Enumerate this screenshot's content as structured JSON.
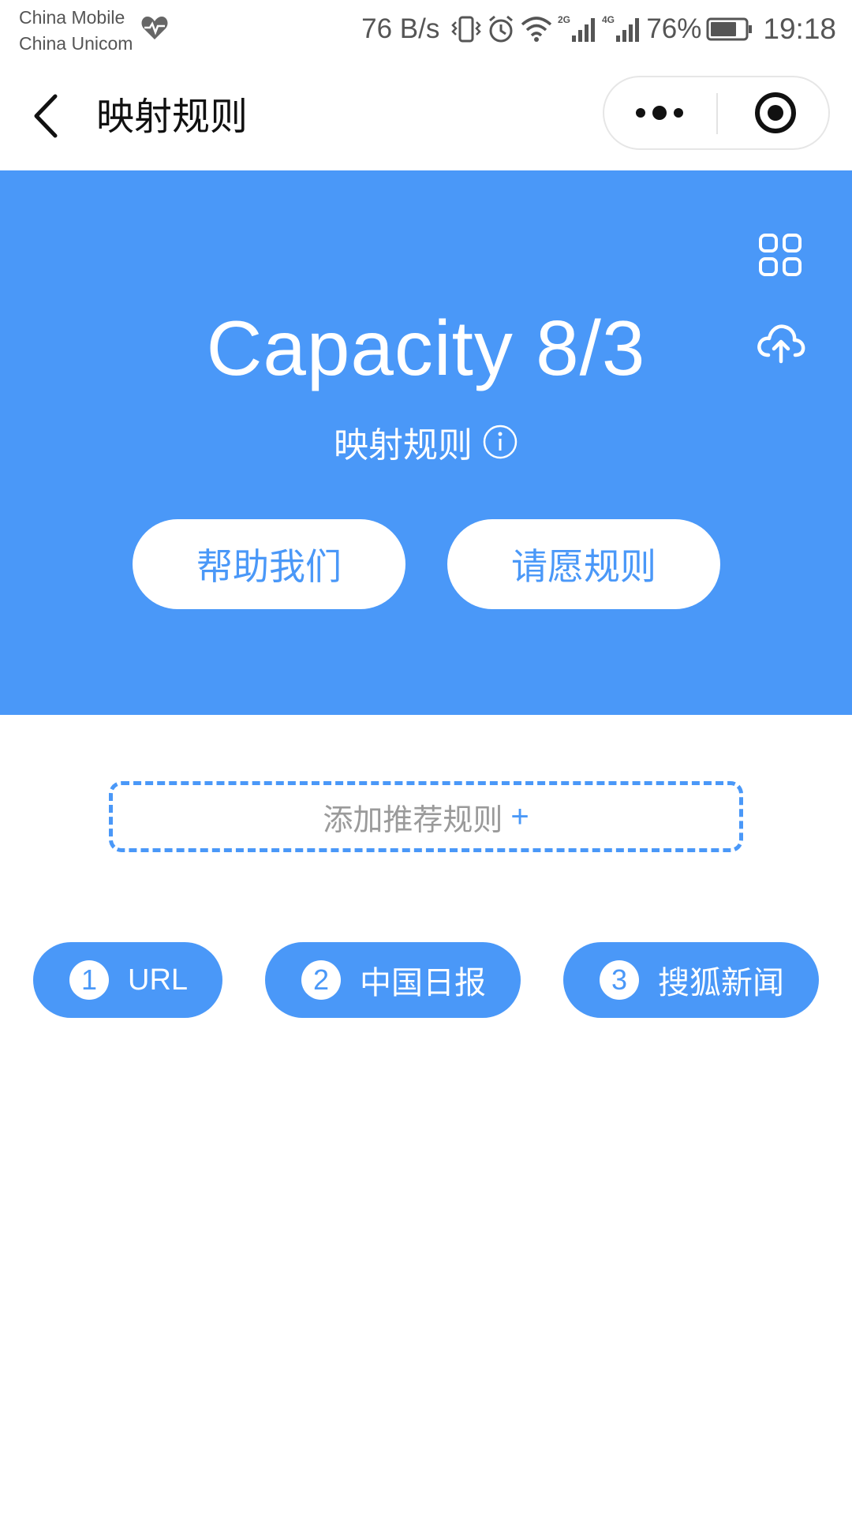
{
  "status_bar": {
    "carrier_1": "China Mobile",
    "carrier_2": "China Unicom",
    "net_speed": "76 B/s",
    "battery_percent": "76%",
    "battery_level": 0.76,
    "time": "19:18",
    "icons": [
      "heart-pulse-icon",
      "vibrate-icon",
      "alarm-icon",
      "wifi-icon",
      "signal-2g-icon",
      "signal-4g-icon",
      "battery-icon"
    ]
  },
  "nav": {
    "title": "映射规则",
    "icons": [
      "back-arrow-icon",
      "more-dots-icon",
      "close-target-icon"
    ]
  },
  "hero": {
    "capacity_text": "Capacity 8/3",
    "subtitle": "映射规则",
    "help_button": "帮助我们",
    "wish_button": "请愿规则",
    "icons": [
      "grid-icon",
      "cloud-upload-icon",
      "info-icon"
    ],
    "background_color": "#4a98f8"
  },
  "add_rule": {
    "label": "添加推荐规则",
    "plus": "+"
  },
  "rules": [
    {
      "number": "1",
      "label": "URL"
    },
    {
      "number": "2",
      "label": "中国日报"
    },
    {
      "number": "3",
      "label": "搜狐新闻"
    }
  ],
  "colors": {
    "accent": "#4a98f8",
    "muted_text": "#9a9a9a"
  }
}
